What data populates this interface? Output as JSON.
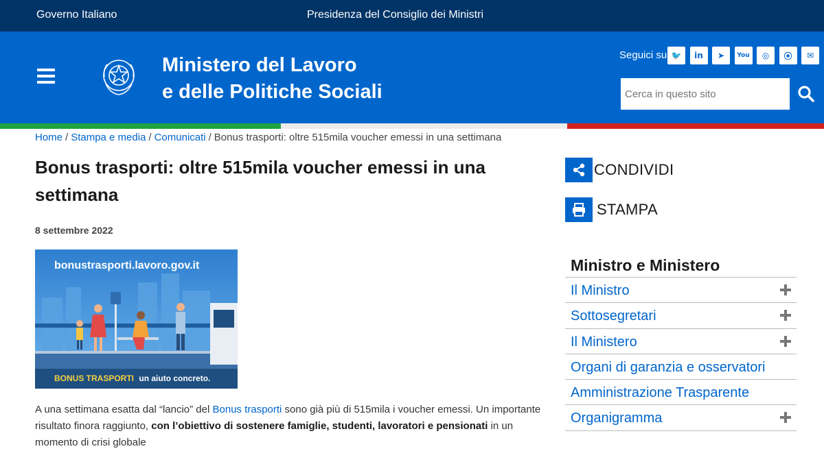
{
  "topbar": {
    "left_link": "Governo Italiano",
    "center_link": "Presidenza del Consiglio dei Ministri"
  },
  "header": {
    "title_line1": "Ministero del Lavoro",
    "title_line2": "e delle Politiche Sociali",
    "follow_label": "Seguici su:",
    "social": [
      {
        "icon": "twitter-icon",
        "glyph": "🐦"
      },
      {
        "icon": "linkedin-icon",
        "glyph": "in"
      },
      {
        "icon": "telegram-icon",
        "glyph": "➤"
      },
      {
        "icon": "youtube-icon",
        "glyph": "You"
      },
      {
        "icon": "instagram-icon",
        "glyph": "◎"
      },
      {
        "icon": "rss-icon",
        "glyph": "⦿"
      },
      {
        "icon": "email-icon",
        "glyph": "✉"
      }
    ],
    "search_placeholder": "Cerca in questo sito"
  },
  "breadcrumb": {
    "items": [
      "Home",
      "Stampa e media",
      "Comunicati"
    ],
    "current": "Bonus trasporti: oltre 515mila voucher emessi in una settimana",
    "separator": "/"
  },
  "article": {
    "title": "Bonus trasporti: oltre 515mila voucher emessi in una settimana",
    "date": "8 settembre 2022",
    "image_url_text": "bonustrasporti.lavoro.gov.it",
    "image_caption_strong": "BONUS TRASPORTI",
    "image_caption_rest": "un aiuto concreto.",
    "body_part1": "A una settimana esatta dal “lancio” del ",
    "body_link": "Bonus trasporti",
    "body_part2": " sono già più di 515mila i voucher emessi. Un importante risultato finora raggiunto, ",
    "body_bold": "con l’obiettivo di sostenere famiglie, studenti, lavoratori e pensionati",
    "body_part3": " in un momento di crisi globale"
  },
  "sidebar": {
    "share_label": "CONDIVIDI",
    "print_label": "STAMPA",
    "heading": "Ministro e Ministero",
    "items": [
      {
        "label": "Il Ministro",
        "expandable": true
      },
      {
        "label": "Sottosegretari",
        "expandable": true
      },
      {
        "label": "Il Ministero",
        "expandable": true
      },
      {
        "label": "Organi di garanzia e osservatori",
        "expandable": false
      },
      {
        "label": "Amministrazione Trasparente",
        "expandable": false
      },
      {
        "label": "Organigramma",
        "expandable": true
      }
    ]
  },
  "colors": {
    "topbar": "#003366",
    "header": "#0066cc",
    "link": "#0066cc",
    "flag_green": "#21a33f",
    "flag_red": "#d42220"
  }
}
